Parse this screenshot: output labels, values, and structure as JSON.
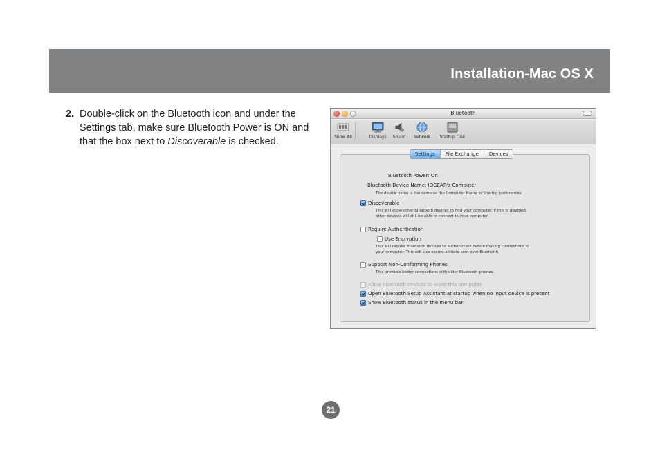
{
  "header": {
    "title": "Installation-Mac OS X"
  },
  "step": {
    "number": "2.",
    "text_before": "Double-click on the Bluetooth icon and under the Settings tab, make sure Bluetooth Power is ON and that the box next to ",
    "emphasis": "Discoverable",
    "text_after": " is checked."
  },
  "page_number": "21",
  "window": {
    "title": "Bluetooth",
    "toolbar": [
      {
        "label": "Show All",
        "icon": "show-all-icon"
      },
      {
        "label": "Displays",
        "icon": "displays-icon"
      },
      {
        "label": "Sound",
        "icon": "sound-icon"
      },
      {
        "label": "Network",
        "icon": "network-icon"
      },
      {
        "label": "Startup Disk",
        "icon": "startup-disk-icon"
      }
    ],
    "tabs": [
      "Settings",
      "File Exchange",
      "Devices"
    ],
    "active_tab": "Settings",
    "power_label": "Bluetooth Power:",
    "power_value": "On",
    "device_name_label": "Bluetooth Device Name:",
    "device_name_value": "IOGEAR's Computer",
    "device_name_note": "The device name is the same as the Computer Name in Sharing preferences.",
    "options": {
      "discoverable": {
        "label": "Discoverable",
        "checked": true,
        "desc1": "This will allow other Bluetooth devices to find your computer.  If this is disabled,",
        "desc2": "other devices will still be able to connect to your computer."
      },
      "require_auth": {
        "label": "Require Authentication",
        "checked": false
      },
      "use_encryption": {
        "label": "Use Encryption",
        "checked": false,
        "desc1": "This will require Bluetooth devices to authenticate before making connections to",
        "desc2": "your computer. This will also secure all data sent over Bluetooth."
      },
      "non_conforming": {
        "label": "Support Non-Conforming Phones",
        "checked": false,
        "desc1": "This provides better connections with older Bluetooth phones."
      },
      "wake": {
        "label": "Allow Bluetooth devices to wake this computer",
        "checked": false,
        "disabled": true
      },
      "setup_assistant": {
        "label": "Open Bluetooth Setup Assistant at startup when no input device is present",
        "checked": true
      },
      "menu_bar_status": {
        "label": "Show Bluetooth status in the menu bar",
        "checked": true
      }
    }
  },
  "colors": {
    "header_band": "#808284",
    "page_badge": "#6d6e70",
    "tab_active": "#6aaee8",
    "checkbox_checked": "#3c86d6"
  }
}
